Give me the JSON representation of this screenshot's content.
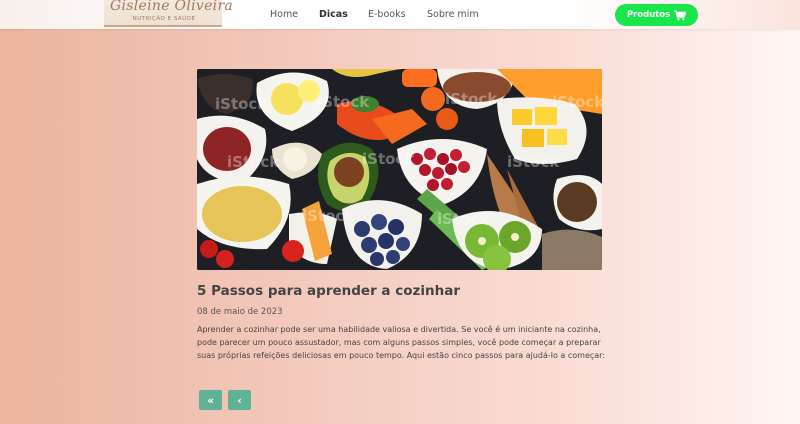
{
  "brand": {
    "name": "Gisleine Oliveira",
    "tagline": "NUTRIÇÃO E SAÚDE"
  },
  "nav": {
    "items": [
      {
        "label": "Home",
        "active": false
      },
      {
        "label": "Dicas",
        "active": true
      },
      {
        "label": "E-books",
        "active": false
      },
      {
        "label": "Sobre mim",
        "active": false
      }
    ],
    "products_button": "Produtos",
    "products_icon": "cart-icon",
    "products_color": "#19e64a"
  },
  "article": {
    "image_watermark": "iStock",
    "title": "5 Passos para aprender a cozinhar",
    "date": "08 de maio de 2023",
    "excerpt": "Aprender a cozinhar pode ser uma habilidade valiosa e divertida. Se você é um iniciante na cozinha, pode parecer um pouco assustador, mas com alguns passos simples, você pode começar a preparar suas próprias refeições deliciosas em pouco tempo. Aqui estão cinco passos para ajudá-lo a começar:"
  },
  "pagination": {
    "first_label": "«",
    "prev_label": "‹",
    "button_color": "#5fb394"
  }
}
